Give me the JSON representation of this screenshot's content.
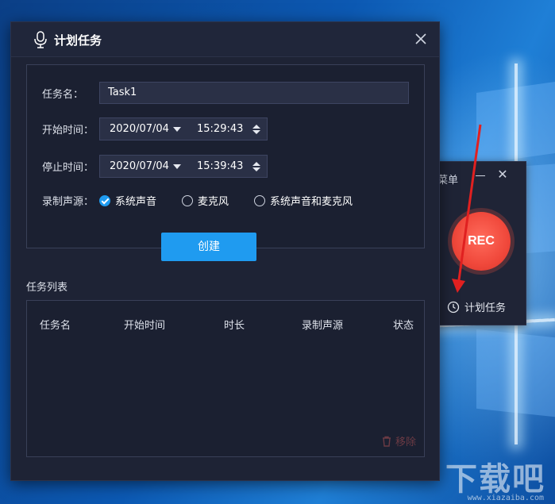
{
  "desktop": {
    "watermark": "下载吧",
    "watermark_url": "www.xiazaiba.com"
  },
  "mini_panel": {
    "menu_label": "菜单",
    "rec_label": "REC",
    "schedule_label": "计划任务",
    "rec_color": "#f0483b"
  },
  "dialog": {
    "title": "计划任务",
    "form": {
      "task_name_label": "任务名：",
      "task_name_value": "Task1",
      "start_label": "开始时间：",
      "start_date": "2020/07/04",
      "start_time": "15:29:43",
      "stop_label": "停止时间：",
      "stop_date": "2020/07/04",
      "stop_time": "15:39:43",
      "audio_label": "录制声源：",
      "audio_options": [
        {
          "label": "系统声音",
          "checked": true
        },
        {
          "label": "麦克风",
          "checked": false
        },
        {
          "label": "系统声音和麦克风",
          "checked": false
        }
      ]
    },
    "create_button": "创建",
    "list": {
      "title": "任务列表",
      "columns": [
        "任务名",
        "开始时间",
        "时长",
        "录制声源",
        "状态"
      ],
      "remove_label": "移除"
    },
    "accent_color": "#1f9bf0"
  }
}
